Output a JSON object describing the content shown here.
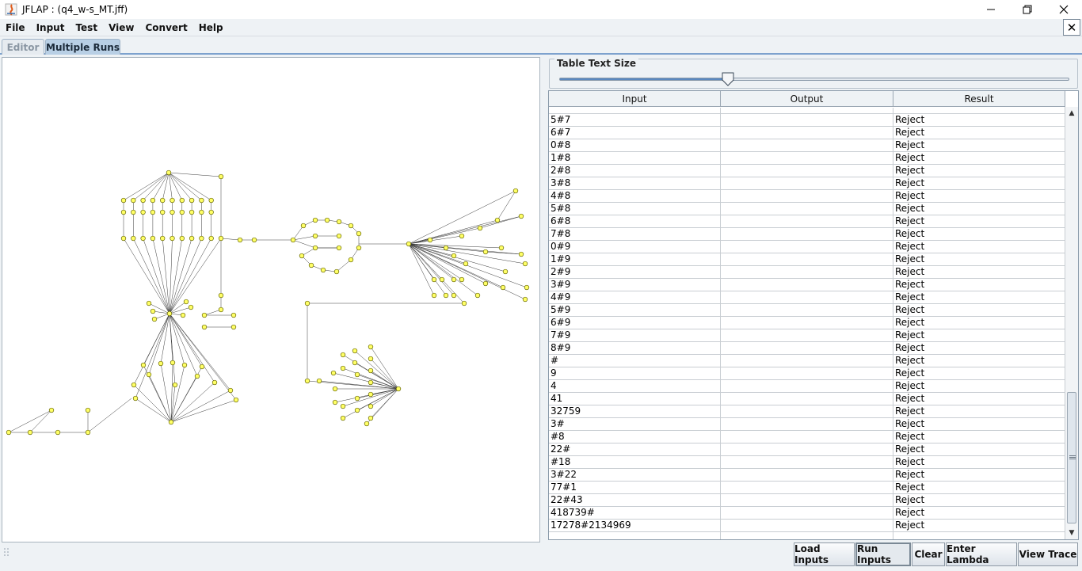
{
  "window": {
    "title": "JFLAP : (q4_w-s_MT.jff)",
    "app_icon": "jflap-icon",
    "controls": [
      "minimize-icon",
      "restore-icon",
      "close-icon"
    ]
  },
  "menu": [
    "File",
    "Input",
    "Test",
    "View",
    "Convert",
    "Help"
  ],
  "tabs": [
    {
      "label": "Editor",
      "active": false
    },
    {
      "label": "Multiple Runs",
      "active": true
    }
  ],
  "table_text_size": {
    "label": "Table Text Size",
    "slider_value_fraction": 0.33
  },
  "table": {
    "columns": [
      "Input",
      "Output",
      "Result"
    ],
    "rows": [
      [
        "",
        "",
        ""
      ],
      [
        "5#7",
        "",
        "Reject"
      ],
      [
        "6#7",
        "",
        "Reject"
      ],
      [
        "0#8",
        "",
        "Reject"
      ],
      [
        "1#8",
        "",
        "Reject"
      ],
      [
        "2#8",
        "",
        "Reject"
      ],
      [
        "3#8",
        "",
        "Reject"
      ],
      [
        "4#8",
        "",
        "Reject"
      ],
      [
        "5#8",
        "",
        "Reject"
      ],
      [
        "6#8",
        "",
        "Reject"
      ],
      [
        "7#8",
        "",
        "Reject"
      ],
      [
        "0#9",
        "",
        "Reject"
      ],
      [
        "1#9",
        "",
        "Reject"
      ],
      [
        "2#9",
        "",
        "Reject"
      ],
      [
        "3#9",
        "",
        "Reject"
      ],
      [
        "4#9",
        "",
        "Reject"
      ],
      [
        "5#9",
        "",
        "Reject"
      ],
      [
        "6#9",
        "",
        "Reject"
      ],
      [
        "7#9",
        "",
        "Reject"
      ],
      [
        "8#9",
        "",
        "Reject"
      ],
      [
        "#",
        "",
        "Reject"
      ],
      [
        "9",
        "",
        "Reject"
      ],
      [
        "4",
        "",
        "Reject"
      ],
      [
        "41",
        "",
        "Reject"
      ],
      [
        "32759",
        "",
        "Reject"
      ],
      [
        "3#",
        "",
        "Reject"
      ],
      [
        "#8",
        "",
        "Reject"
      ],
      [
        "22#",
        "",
        "Reject"
      ],
      [
        "#18",
        "",
        "Reject"
      ],
      [
        "3#22",
        "",
        "Reject"
      ],
      [
        "77#1",
        "",
        "Reject"
      ],
      [
        "22#43",
        "",
        "Reject"
      ],
      [
        "418739#",
        "",
        "Reject"
      ],
      [
        "17278#2134969",
        "",
        "Reject"
      ],
      [
        "",
        "",
        ""
      ]
    ]
  },
  "buttons": [
    {
      "label": "Load Inputs",
      "pressed": false
    },
    {
      "label": "Run Inputs",
      "pressed": true
    },
    {
      "label": "Clear",
      "pressed": false
    },
    {
      "label": "Enter Lambda",
      "pressed": false
    },
    {
      "label": "View Trace",
      "pressed": false
    }
  ],
  "colors": {
    "state_fill": "#ffff66",
    "state_stroke": "#666600",
    "accent": "#5a88c0"
  }
}
